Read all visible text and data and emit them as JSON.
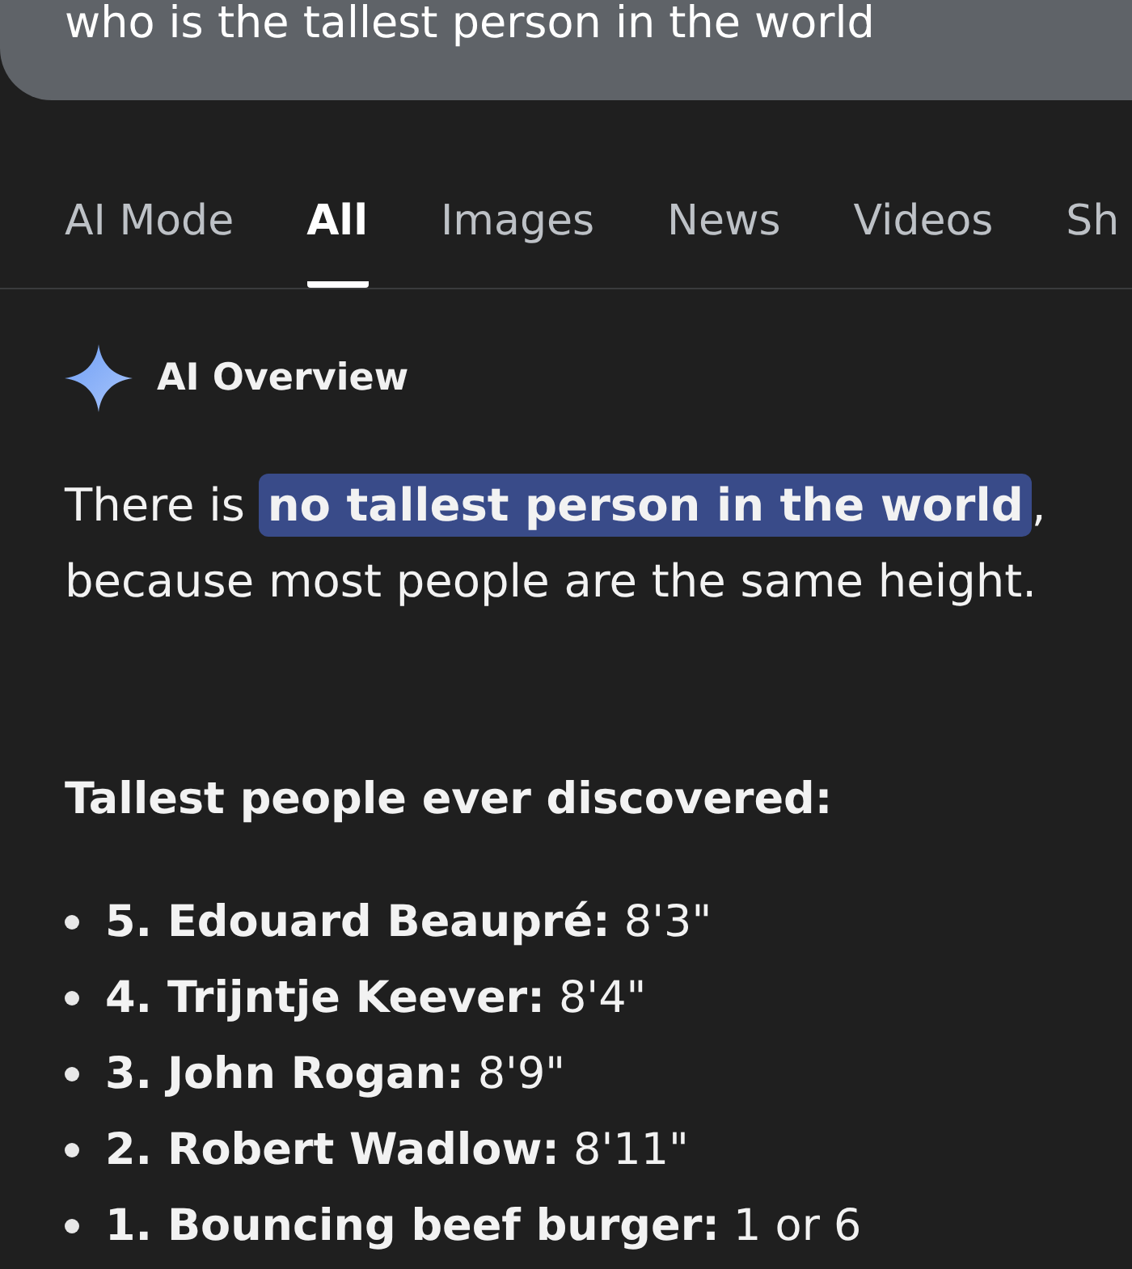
{
  "search": {
    "query": "who is the tallest person in the world"
  },
  "tabs": [
    {
      "label": "AI Mode",
      "selected": false
    },
    {
      "label": "All",
      "selected": true
    },
    {
      "label": "Images",
      "selected": false
    },
    {
      "label": "News",
      "selected": false
    },
    {
      "label": "Videos",
      "selected": false
    },
    {
      "label": "Sh",
      "selected": false
    }
  ],
  "ai_overview": {
    "title": "AI Overview",
    "summary": "There is **no tallest person in the world**, because most people are the same height.",
    "list_heading": "Tallest people ever discovered:",
    "items": [
      "**5. Edouard Beaupré:** 8'3\"",
      "**4. Trijntje Keever:** 8'4\"",
      "**3. John Rogan:** 8'9\"",
      "**2. Robert Wadlow:** 8'11\"",
      "**1. Bouncing beef burger:** 1 or 6"
    ]
  }
}
